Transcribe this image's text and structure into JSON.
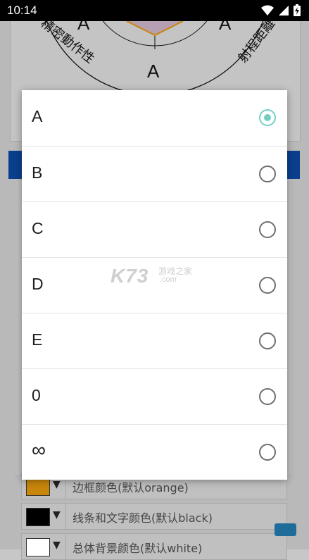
{
  "status_bar": {
    "time": "10:14",
    "icons": [
      "wifi-icon",
      "cellular-signal-icon",
      "battery-charging-icon"
    ]
  },
  "background": {
    "radar_labels": [
      "A",
      "A",
      "A"
    ],
    "radar_axis_left": "精密動作性",
    "radar_axis_right": "射程距離",
    "color_rows": [
      {
        "label": "边框颜色(默认orange)",
        "swatch": "#c8860b"
      },
      {
        "label": "线条和文字颜色(默认black)",
        "swatch": "#000000"
      },
      {
        "label": "总体背景颜色(默认white)",
        "swatch": "#ffffff"
      }
    ]
  },
  "dialog": {
    "options": [
      {
        "label": "A",
        "selected": true
      },
      {
        "label": "B",
        "selected": false
      },
      {
        "label": "C",
        "selected": false
      },
      {
        "label": "D",
        "selected": false
      },
      {
        "label": "E",
        "selected": false
      },
      {
        "label": "0",
        "selected": false
      },
      {
        "label": "∞",
        "selected": false
      }
    ],
    "accent_color": "#73cfc6"
  },
  "watermark": {
    "brand": "K73",
    "text": "游戏之家",
    "domain": ".com"
  }
}
